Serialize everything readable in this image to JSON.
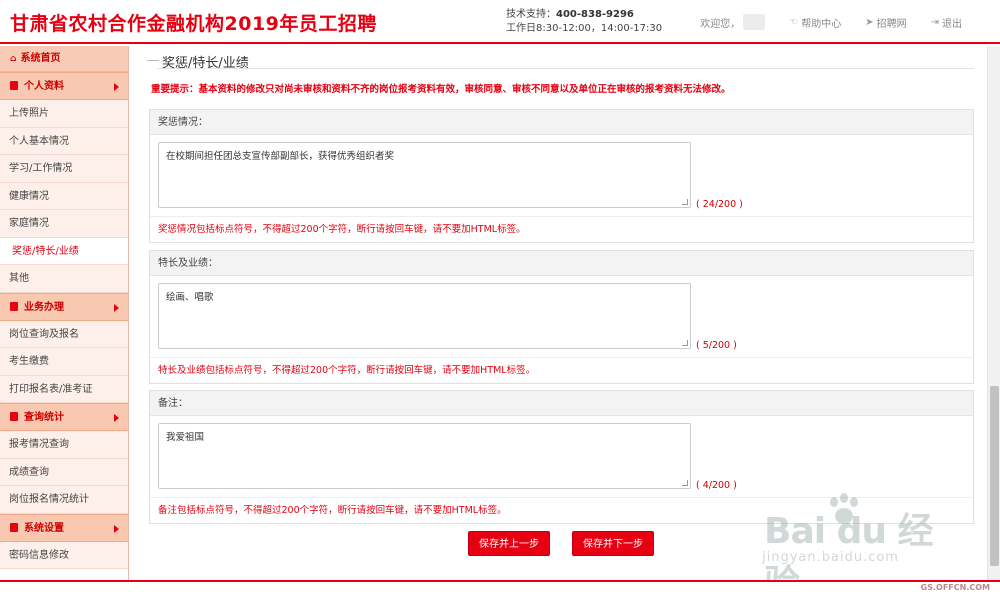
{
  "header": {
    "title": "甘肃省农村合作金融机构2019年员工招聘",
    "support_label": "技术支持：",
    "support_tel": "400-838-9296",
    "hours": "工作日8:30-12:00，14:00-17:30",
    "welcome": "欢迎您，",
    "help": "帮助中心",
    "recruit": "招聘网",
    "logout": "退出"
  },
  "sidebar": {
    "home": "系统首页",
    "groups": [
      {
        "label": "个人资料",
        "items": [
          "上传照片",
          "个人基本情况",
          "学习/工作情况",
          "健康情况",
          "家庭情况",
          "奖惩/特长/业绩",
          "其他"
        ]
      },
      {
        "label": "业务办理",
        "items": [
          "岗位查询及报名",
          "考生缴费",
          "打印报名表/准考证"
        ]
      },
      {
        "label": "查询统计",
        "items": [
          "报考情况查询",
          "成绩查询",
          "岗位报名情况统计"
        ]
      },
      {
        "label": "系统设置",
        "items": [
          "密码信息修改"
        ]
      }
    ],
    "active_item": "奖惩/特长/业绩"
  },
  "main": {
    "section_title": "奖惩/特长/业绩",
    "notice": "重要提示：基本资料的修改只对尚未审核和资料不齐的岗位报考资料有效，审核同意、审核不同意以及单位正在审核的报考资料无法修改。",
    "panels": [
      {
        "label": "奖惩情况：",
        "value": "在校期间担任团总支宣传部副部长，获得优秀组织者奖",
        "count": "( 24/200 )",
        "hint": "奖惩情况包括标点符号，不得超过200个字符，断行请按回车键，请不要加HTML标签。"
      },
      {
        "label": "特长及业绩：",
        "value": "绘画、唱歌",
        "count": "( 5/200 )",
        "hint": "特长及业绩包括标点符号，不得超过200个字符，断行请按回车键，请不要加HTML标签。"
      },
      {
        "label": "备注：",
        "value": "我爱祖国",
        "count": "( 4/200 )",
        "hint": "备注包括标点符号，不得超过200个字符，断行请按回车键，请不要加HTML标签。"
      }
    ],
    "btn_prev": "保存并上一步",
    "btn_next": "保存并下一步"
  },
  "watermarks": {
    "baidu": "Bai du 经验",
    "baidu_sub": "jingyan.baidu.com",
    "offcn": "GS.OFFCN.COM"
  },
  "colors": {
    "accent": "#e60012",
    "sidebar_group_bg": "#f8c8b0",
    "sidebar_item_bg": "#fdf0ea"
  }
}
